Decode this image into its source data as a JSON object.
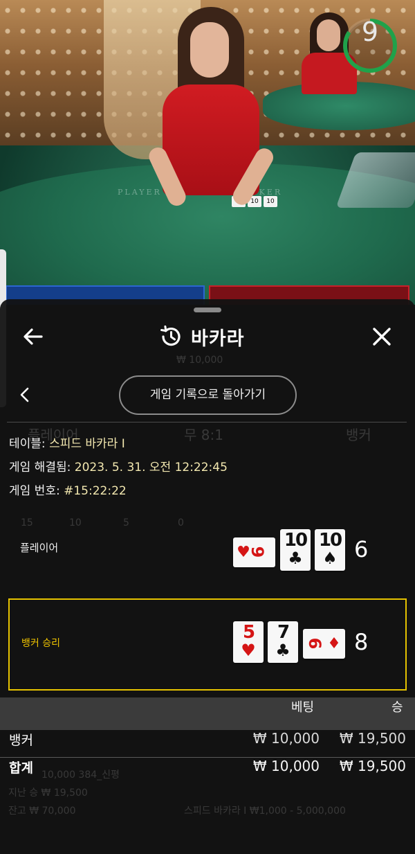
{
  "timer": {
    "value": "9",
    "color": "#1fa24a"
  },
  "video": {
    "table_text_player": "PLAYER",
    "table_text_banker": "BANKER",
    "card_a": "8",
    "card_b": "10",
    "card_c": "10"
  },
  "header": {
    "title": "바카라",
    "back_icon": "arrow-left-icon",
    "history_icon": "history-icon",
    "close_icon": "close-icon"
  },
  "history": {
    "back_button_label": "게임 기록으로 돌아가기",
    "table_label": "테이블:",
    "table_value": "스피드 바카라 I",
    "resolved_label": "게임 해결됨:",
    "resolved_value": "2023. 5. 31. 오전 12:22:45",
    "round_label": "게임 번호:",
    "round_value": "#15:22:22"
  },
  "results": {
    "player": {
      "label": "플레이어",
      "score": "6",
      "cards": [
        {
          "rank": "9",
          "suit": "♥",
          "color": "red",
          "orientation": "horizontal"
        },
        {
          "rank": "10",
          "suit": "♣",
          "color": "black",
          "orientation": "vertical"
        },
        {
          "rank": "10",
          "suit": "♠",
          "color": "black",
          "orientation": "vertical"
        }
      ]
    },
    "banker": {
      "label": "뱅커 승리",
      "score": "8",
      "cards": [
        {
          "rank": "5",
          "suit": "♥",
          "color": "red",
          "orientation": "vertical"
        },
        {
          "rank": "7",
          "suit": "♣",
          "color": "black",
          "orientation": "vertical"
        },
        {
          "rank": "6",
          "suit": "♦",
          "color": "red",
          "orientation": "horizontal"
        }
      ]
    }
  },
  "bets": {
    "col_bet": "베팅",
    "col_win": "승",
    "rows": [
      {
        "name": "뱅커",
        "bet": "₩ 10,000",
        "win": "₩ 19,500"
      }
    ],
    "total": {
      "name": "합계",
      "bet": "₩ 10,000",
      "win": "₩ 19,500"
    }
  },
  "background_ui": {
    "player_tab": "플레이어",
    "tie_tab": "무 8:1",
    "banker_tab": "뱅커",
    "stats_1": "15",
    "stats_2": "10",
    "stats_3": "5",
    "stats_4": "0",
    "balance_line": "10,000 384_신평",
    "last_win": "지난 승 ₩ 19,500",
    "balance": "잔고 ₩ 70,000",
    "table_limits": "스피드 바카라 I ₩1,000 - 5,000,000",
    "chip_value": "₩ 10,000"
  }
}
